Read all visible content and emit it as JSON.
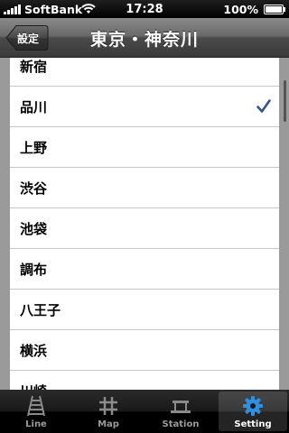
{
  "status_bar": {
    "carrier": "SoftBank",
    "time": "17:28",
    "battery": "100%"
  },
  "nav_bar": {
    "back_label": "設定",
    "title": "東京・神奈川"
  },
  "list": {
    "items": [
      {
        "label": "新宿",
        "checked": false
      },
      {
        "label": "品川",
        "checked": true
      },
      {
        "label": "上野",
        "checked": false
      },
      {
        "label": "渋谷",
        "checked": false
      },
      {
        "label": "池袋",
        "checked": false
      },
      {
        "label": "調布",
        "checked": false
      },
      {
        "label": "八王子",
        "checked": false
      },
      {
        "label": "横浜",
        "checked": false
      },
      {
        "label": "川崎",
        "checked": false
      }
    ],
    "check_color": "#385487"
  },
  "tab_bar": {
    "tabs": [
      {
        "label": "Line",
        "icon": "train-line-icon",
        "selected": false
      },
      {
        "label": "Map",
        "icon": "grid-map-icon",
        "selected": false
      },
      {
        "label": "Station",
        "icon": "station-icon",
        "selected": false
      },
      {
        "label": "Setting",
        "icon": "gear-icon",
        "selected": true
      }
    ],
    "active_icon_color": "#2f8fe0"
  }
}
